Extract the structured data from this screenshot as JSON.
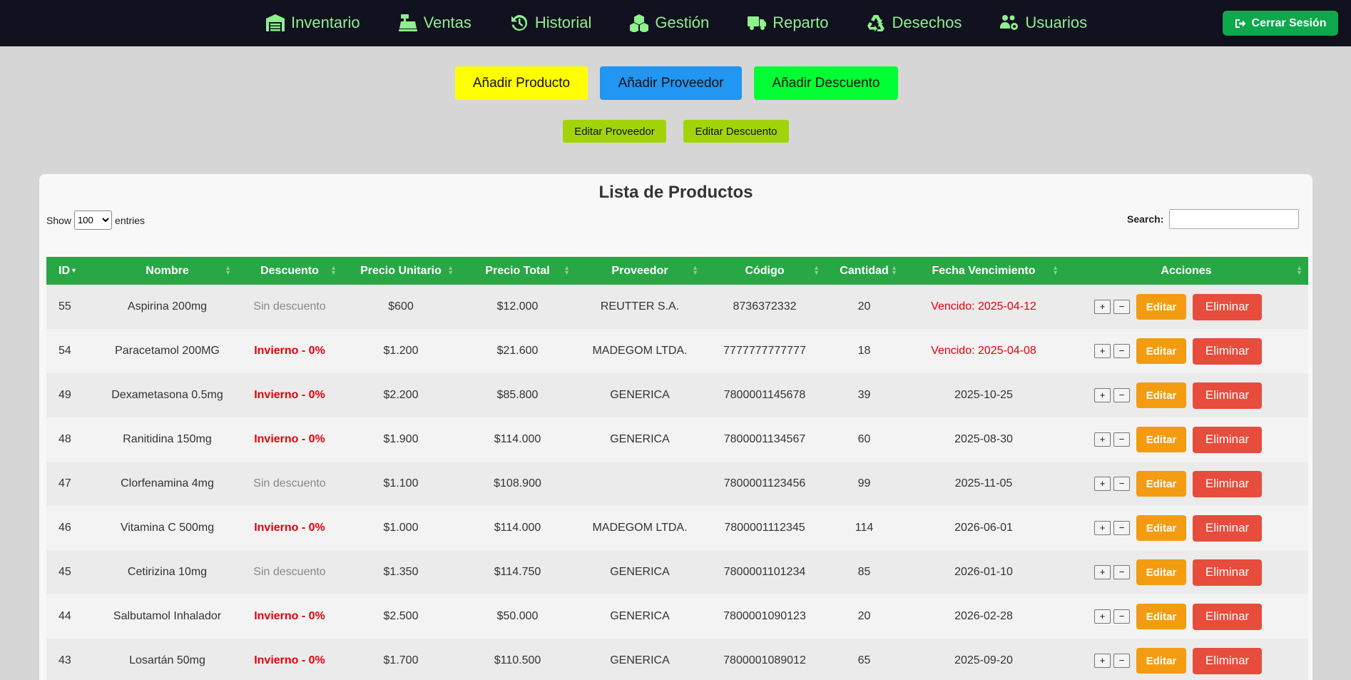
{
  "nav": {
    "items": [
      {
        "label": "Inventario",
        "icon": "warehouse-icon"
      },
      {
        "label": "Ventas",
        "icon": "cash-register-icon"
      },
      {
        "label": "Historial",
        "icon": "history-icon"
      },
      {
        "label": "Gestión",
        "icon": "cubes-icon"
      },
      {
        "label": "Reparto",
        "icon": "truck-icon"
      },
      {
        "label": "Desechos",
        "icon": "recycle-icon"
      },
      {
        "label": "Usuarios",
        "icon": "users-gear-icon"
      }
    ],
    "logout_label": "Cerrar Sesión"
  },
  "actions": {
    "add_product": "Añadir Producto",
    "add_supplier": "Añadir Proveedor",
    "add_discount": "Añadir Descuento",
    "edit_supplier": "Editar Proveedor",
    "edit_discount": "Editar Descuento"
  },
  "colors": {
    "add_product_bg": "#ffff00",
    "add_supplier_bg": "#2196f3",
    "add_discount_bg": "#00ff33",
    "table_header_bg": "#28a745",
    "edit_btn": "#f39c12",
    "delete_btn": "#e74c3c"
  },
  "table": {
    "title": "Lista de Productos",
    "show_label": "Show",
    "entries_label": "entries",
    "page_size": "100",
    "search_label": "Search:",
    "columns": [
      "ID",
      "Nombre",
      "Descuento",
      "Precio Unitario",
      "Precio Total",
      "Proveedor",
      "Código",
      "Cantidad",
      "Fecha Vencimiento",
      "Acciones"
    ],
    "rows": [
      {
        "id": "55",
        "nombre": "Aspirina 200mg",
        "descuento": "Sin descuento",
        "precio_unitario": "$600",
        "precio_total": "$12.000",
        "proveedor": "REUTTER S.A.",
        "codigo": "8736372332",
        "cantidad": "20",
        "vencimiento": "Vencido: 2025-04-12"
      },
      {
        "id": "54",
        "nombre": "Paracetamol 200MG",
        "descuento": "Invierno - 0%",
        "precio_unitario": "$1.200",
        "precio_total": "$21.600",
        "proveedor": "MADEGOM LTDA.",
        "codigo": "7777777777777",
        "cantidad": "18",
        "vencimiento": "Vencido: 2025-04-08"
      },
      {
        "id": "49",
        "nombre": "Dexametasona 0.5mg",
        "descuento": "Invierno - 0%",
        "precio_unitario": "$2.200",
        "precio_total": "$85.800",
        "proveedor": "GENERICA",
        "codigo": "7800001145678",
        "cantidad": "39",
        "vencimiento": "2025-10-25"
      },
      {
        "id": "48",
        "nombre": "Ranitidina 150mg",
        "descuento": "Invierno - 0%",
        "precio_unitario": "$1.900",
        "precio_total": "$114.000",
        "proveedor": "GENERICA",
        "codigo": "7800001134567",
        "cantidad": "60",
        "vencimiento": "2025-08-30"
      },
      {
        "id": "47",
        "nombre": "Clorfenamina 4mg",
        "descuento": "Sin descuento",
        "precio_unitario": "$1.100",
        "precio_total": "$108.900",
        "proveedor": "",
        "codigo": "7800001123456",
        "cantidad": "99",
        "vencimiento": "2025-11-05"
      },
      {
        "id": "46",
        "nombre": "Vitamina C 500mg",
        "descuento": "Invierno - 0%",
        "precio_unitario": "$1.000",
        "precio_total": "$114.000",
        "proveedor": "MADEGOM LTDA.",
        "codigo": "7800001112345",
        "cantidad": "114",
        "vencimiento": "2026-06-01"
      },
      {
        "id": "45",
        "nombre": "Cetirizina 10mg",
        "descuento": "Sin descuento",
        "precio_unitario": "$1.350",
        "precio_total": "$114.750",
        "proveedor": "GENERICA",
        "codigo": "7800001101234",
        "cantidad": "85",
        "vencimiento": "2026-01-10"
      },
      {
        "id": "44",
        "nombre": "Salbutamol Inhalador",
        "descuento": "Invierno - 0%",
        "precio_unitario": "$2.500",
        "precio_total": "$50.000",
        "proveedor": "GENERICA",
        "codigo": "7800001090123",
        "cantidad": "20",
        "vencimiento": "2026-02-28"
      },
      {
        "id": "43",
        "nombre": "Losartán 50mg",
        "descuento": "Invierno - 0%",
        "precio_unitario": "$1.700",
        "precio_total": "$110.500",
        "proveedor": "GENERICA",
        "codigo": "7800001089012",
        "cantidad": "65",
        "vencimiento": "2025-09-20"
      }
    ],
    "row_actions": {
      "plus": "+",
      "minus": "−",
      "edit": "Editar",
      "delete": "Eliminar"
    }
  }
}
